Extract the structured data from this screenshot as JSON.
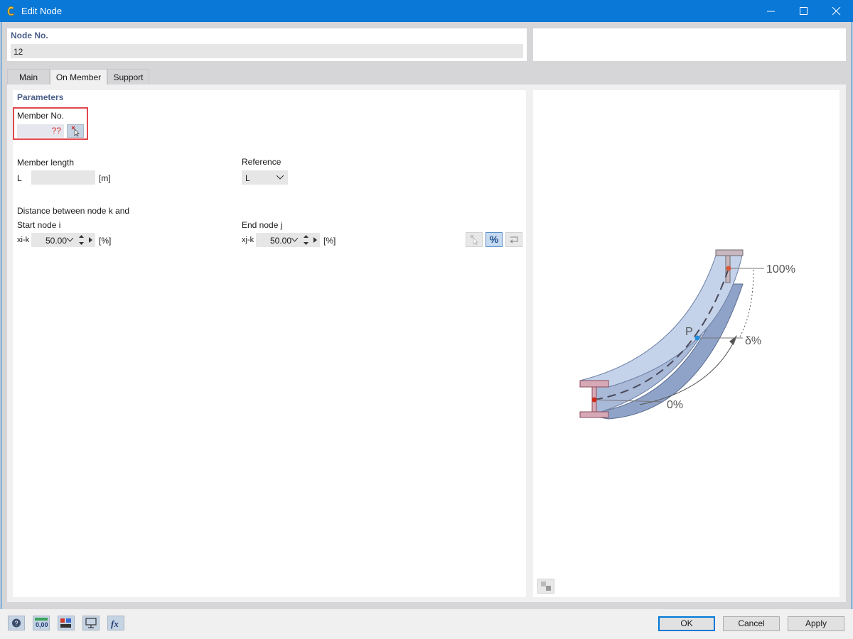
{
  "window": {
    "title": "Edit Node",
    "controls": [
      "minimize-icon",
      "maximize-icon",
      "close-icon"
    ]
  },
  "node": {
    "label": "Node No.",
    "value": "12"
  },
  "tabs": [
    {
      "label": "Main",
      "active": false
    },
    {
      "label": "On Member",
      "active": true
    },
    {
      "label": "Support",
      "active": false
    }
  ],
  "parameters": {
    "section_label": "Parameters",
    "member_no_label": "Member No.",
    "member_no_value": "??",
    "member_length_label": "Member length",
    "length_symbol": "L",
    "length_value": "",
    "length_unit": "[m]",
    "reference_label": "Reference",
    "reference_value": "L",
    "distance_label": "Distance between node k and",
    "start_label": "Start node i",
    "start_symbol": "xi-k",
    "start_value": "50.00",
    "start_unit": "[%]",
    "end_label": "End node j",
    "end_symbol": "xj-k",
    "end_value": "50.00",
    "end_unit": "[%]"
  },
  "diagram": {
    "label_100": "100%",
    "label_delta": "δ%",
    "label_0": "0%",
    "label_p": "P"
  },
  "footer": {
    "ok": "OK",
    "cancel": "Cancel",
    "apply": "Apply",
    "tool_icons": [
      "help-icon",
      "units-icon",
      "display-icon",
      "view-icon",
      "formula-icon"
    ]
  },
  "colors": {
    "titlebar": "#0a78d7",
    "highlight": "#e0484e",
    "error_text": "#e0322e",
    "beam": "#b4c6e0"
  }
}
